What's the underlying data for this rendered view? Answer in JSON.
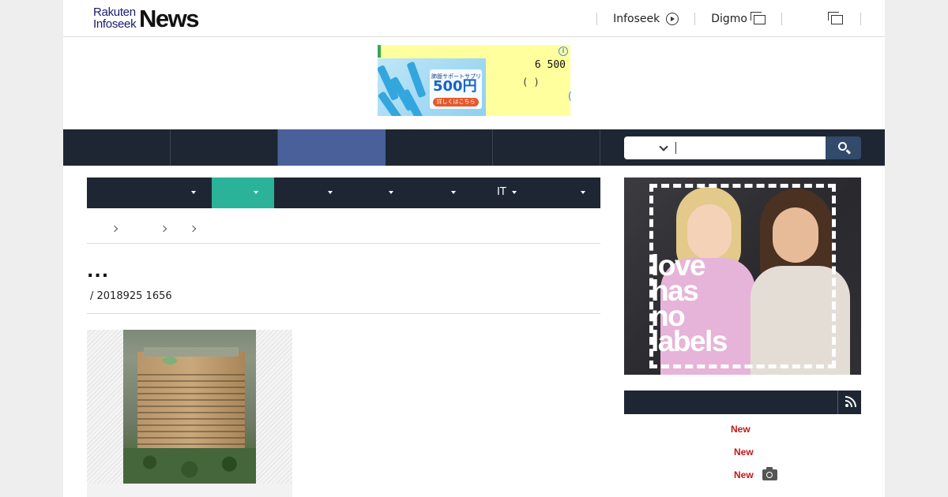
{
  "header": {
    "logo": {
      "line1": "Rakuten",
      "line2": "Infoseek",
      "brand": "News"
    },
    "links": [
      {
        "label": "Infoseek",
        "icon": "circle-play-icon"
      },
      {
        "label": "Digmo",
        "icon": "external-window-icon"
      },
      {
        "label": "",
        "icon": "external-window-icon"
      }
    ]
  },
  "ad": {
    "subtitle": "肺脈サポートサプリ",
    "price": "500円",
    "button_label": "詳しくはこちら",
    "line1": "6  500",
    "line2": "( )",
    "line3": "("
  },
  "nav": {
    "active_index": 2,
    "search": {
      "value": "",
      "placeholder": ""
    }
  },
  "subnav": {
    "active_index": 1,
    "items": [
      {
        "label": ""
      },
      {
        "label": ""
      },
      {
        "label": ""
      },
      {
        "label": ""
      },
      {
        "label": ""
      },
      {
        "label": "IT"
      },
      {
        "label": ""
      }
    ]
  },
  "article": {
    "title": "...",
    "date": "/ 2018925 1656"
  },
  "side_ad": {
    "text_line1": "love",
    "text_line2": "has",
    "text_line3": "no",
    "text_line4": "labels"
  },
  "side_list": {
    "new_label": "New",
    "items": [
      {
        "badge": "New"
      },
      {
        "badge": "New"
      },
      {
        "badge": "New",
        "icon": "camera-icon"
      }
    ]
  },
  "colors": {
    "nav_bg": "#1e2633",
    "nav_active": "#4a609b",
    "subnav_active": "#2bb39a",
    "new_red": "#c4161c",
    "search_btn": "#324a6b"
  }
}
